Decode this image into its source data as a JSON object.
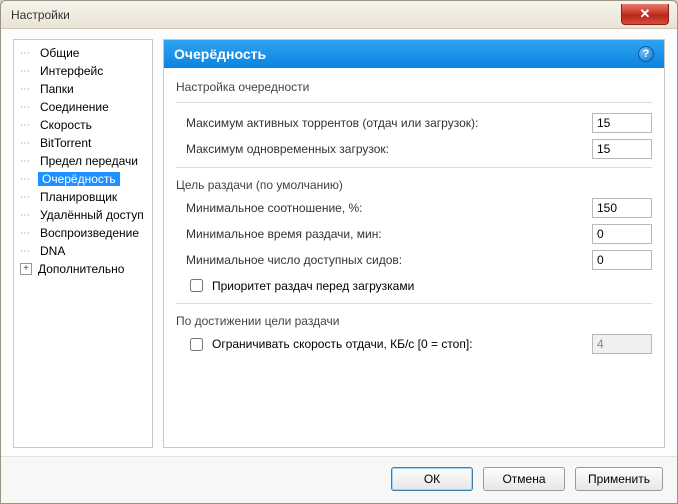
{
  "window": {
    "title": "Настройки"
  },
  "tree": {
    "items": [
      {
        "label": "Общие"
      },
      {
        "label": "Интерфейс"
      },
      {
        "label": "Папки"
      },
      {
        "label": "Соединение"
      },
      {
        "label": "Скорость"
      },
      {
        "label": "BitTorrent"
      },
      {
        "label": "Предел передачи"
      },
      {
        "label": "Очерёдность",
        "selected": true
      },
      {
        "label": "Планировщик"
      },
      {
        "label": "Удалённый доступ"
      },
      {
        "label": "Воспроизведение"
      },
      {
        "label": "DNA"
      },
      {
        "label": "Дополнительно",
        "expandable": true
      }
    ]
  },
  "panel": {
    "title": "Очерёдность",
    "group1": "Настройка очередности",
    "max_active_label": "Максимум активных торрентов (отдач или загрузок):",
    "max_active_value": "15",
    "max_downloads_label": "Максимум одновременных загрузок:",
    "max_downloads_value": "15",
    "group2": "Цель раздачи (по умолчанию)",
    "min_ratio_label": "Минимальное соотношение, %:",
    "min_ratio_value": "150",
    "min_time_label": "Минимальное время раздачи, мин:",
    "min_time_value": "0",
    "min_seeds_label": "Минимальное число доступных сидов:",
    "min_seeds_value": "0",
    "priority_checkbox": "Приоритет раздач перед загрузками",
    "group3": "По достижении цели раздачи",
    "limit_checkbox": "Ограничивать скорость отдачи, КБ/с [0 = стоп]:",
    "limit_value": "4"
  },
  "buttons": {
    "ok": "ОК",
    "cancel": "Отмена",
    "apply": "Применить"
  }
}
